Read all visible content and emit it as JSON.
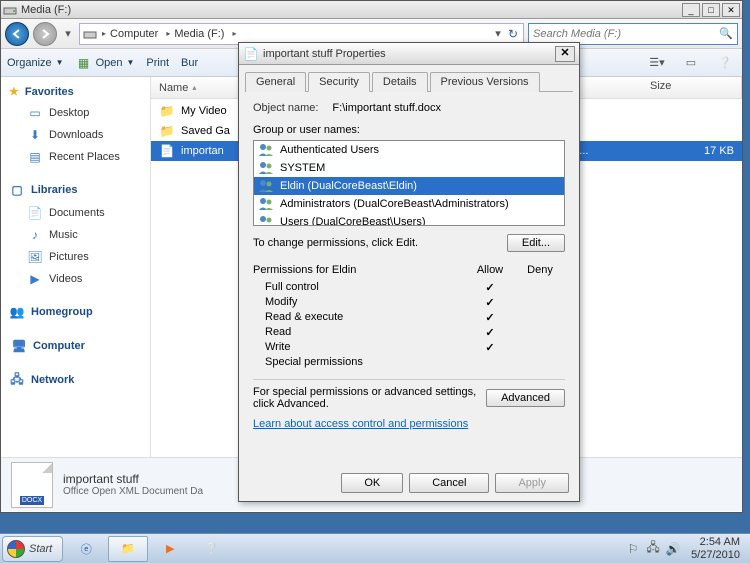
{
  "explorer": {
    "title": "Media (F:)",
    "breadcrumbs": [
      "Computer",
      "Media (F:)"
    ],
    "search_placeholder": "Search Media (F:)",
    "toolbar": {
      "organize": "Organize",
      "open": "Open",
      "print": "Print",
      "burn": "Bur"
    },
    "columns": {
      "name": "Name",
      "size": "Size"
    },
    "nav": {
      "favorites": "Favorites",
      "fav_items": [
        "Desktop",
        "Downloads",
        "Recent Places"
      ],
      "libraries": "Libraries",
      "lib_items": [
        "Documents",
        "Music",
        "Pictures",
        "Videos"
      ],
      "homegroup": "Homegroup",
      "computer": "Computer",
      "network": "Network"
    },
    "files": [
      {
        "name": "My Video",
        "type": "",
        "size": ""
      },
      {
        "name": "Saved Ga",
        "type": "",
        "size": ""
      },
      {
        "name": "importan",
        "type": "XML ...",
        "size": "17 KB",
        "selected": true
      }
    ],
    "details": {
      "name": "important stuff",
      "type": "Office Open XML Document  Da",
      "ext": "DOCX"
    }
  },
  "dialog": {
    "title": "important stuff Properties",
    "tabs": [
      "General",
      "Security",
      "Details",
      "Previous Versions"
    ],
    "active_tab": 1,
    "object_label": "Object name:",
    "object_value": "F:\\important stuff.docx",
    "group_label": "Group or user names:",
    "users": [
      "Authenticated Users",
      "SYSTEM",
      "Eldin (DualCoreBeast\\Eldin)",
      "Administrators (DualCoreBeast\\Administrators)",
      "Users (DualCoreBeast\\Users)"
    ],
    "selected_user": 2,
    "edit_text": "To change permissions, click Edit.",
    "edit_btn": "Edit...",
    "perm_label": "Permissions for Eldin",
    "allow": "Allow",
    "deny": "Deny",
    "perms": [
      {
        "name": "Full control",
        "allow": true
      },
      {
        "name": "Modify",
        "allow": true
      },
      {
        "name": "Read & execute",
        "allow": true
      },
      {
        "name": "Read",
        "allow": true
      },
      {
        "name": "Write",
        "allow": true
      },
      {
        "name": "Special permissions",
        "allow": false
      }
    ],
    "adv_text": "For special permissions or advanced settings, click Advanced.",
    "adv_btn": "Advanced",
    "link": "Learn about access control and permissions",
    "ok": "OK",
    "cancel": "Cancel",
    "apply": "Apply"
  },
  "taskbar": {
    "start": "Start",
    "time": "2:54 AM",
    "date": "5/27/2010"
  }
}
